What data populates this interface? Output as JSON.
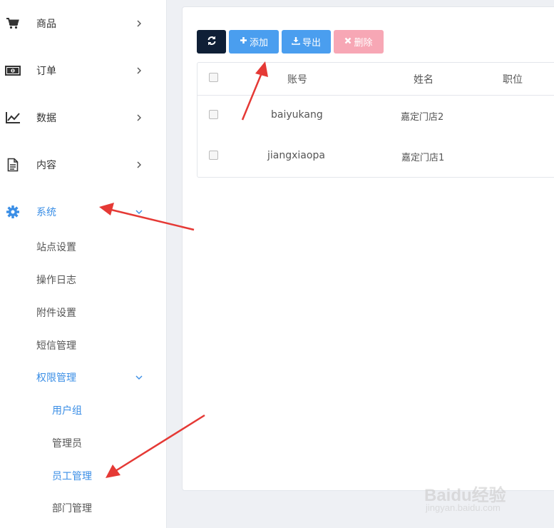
{
  "sidebar": {
    "items": [
      {
        "label": "商品",
        "icon": "cart-icon"
      },
      {
        "label": "订单",
        "icon": "money-icon"
      },
      {
        "label": "数据",
        "icon": "chart-line-icon"
      },
      {
        "label": "内容",
        "icon": "document-icon"
      },
      {
        "label": "系统",
        "icon": "gear-icon"
      }
    ],
    "system_sub": [
      "站点设置",
      "操作日志",
      "附件设置",
      "短信管理",
      "权限管理"
    ],
    "permission_sub": [
      "用户组",
      "管理员",
      "员工管理",
      "部门管理"
    ]
  },
  "toolbar": {
    "add_label": "添加",
    "export_label": "导出",
    "delete_label": "删除"
  },
  "table": {
    "headers": [
      "账号",
      "姓名",
      "职位"
    ],
    "rows": [
      {
        "account": "baiyukang",
        "name": "嘉定门店2"
      },
      {
        "account": "jiangxiaopa",
        "name": "嘉定门店1"
      }
    ]
  },
  "watermark": {
    "text": "Baidu经验",
    "url": "jingyan.baidu.com"
  },
  "colors": {
    "accent": "#3a8ee6",
    "button_primary": "#4a9eef",
    "button_dark": "#0f1f36",
    "button_danger": "#f7a7b5",
    "arrow": "#e53935"
  }
}
